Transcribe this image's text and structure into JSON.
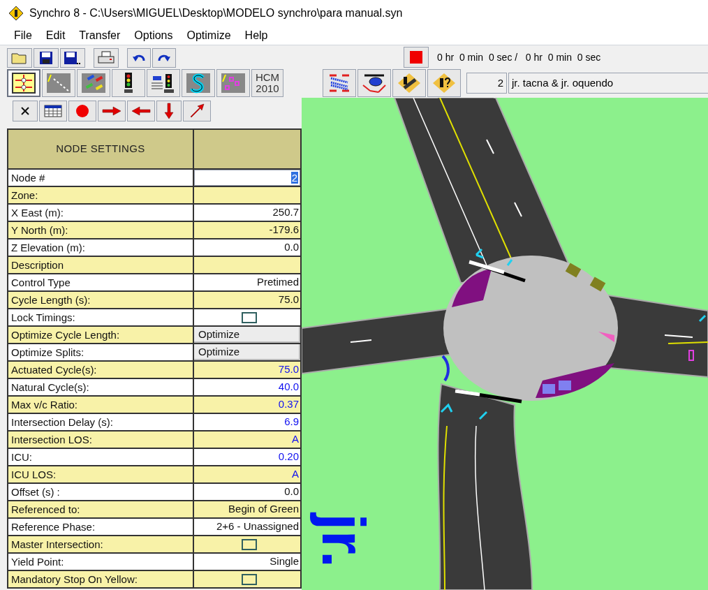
{
  "window": {
    "title": "Synchro 8 - C:\\Users\\MIGUEL\\Desktop\\MODELO synchro\\para manual.syn"
  },
  "menu": [
    "File",
    "Edit",
    "Transfer",
    "Options",
    "Optimize",
    "Help"
  ],
  "toolbar": {
    "hcm_button": "HCM 2010",
    "timer": "0 hr  0 min  0 sec /   0 hr  0 min  0 sec",
    "node_number": "2",
    "node_name": "jr. tacna & jr. oquendo"
  },
  "node_settings": {
    "title": "NODE SETTINGS",
    "rows": [
      {
        "label": "Node #",
        "kind": "input",
        "value": "2",
        "selected": true
      },
      {
        "label": "Zone:",
        "kind": "text",
        "value": ""
      },
      {
        "label": "X East (m):",
        "kind": "text",
        "value": "250.7",
        "calculated": false
      },
      {
        "label": "Y North (m):",
        "kind": "text",
        "value": "-179.6",
        "calculated": false
      },
      {
        "label": "Z Elevation (m):",
        "kind": "text",
        "value": "0.0",
        "calculated": false
      },
      {
        "label": "Description",
        "kind": "text",
        "value": ""
      },
      {
        "label": "Control Type",
        "kind": "text",
        "value": "Pretimed",
        "calculated": false
      },
      {
        "label": "Cycle Length (s):",
        "kind": "text",
        "value": "75.0",
        "calculated": false
      },
      {
        "label": "Lock Timings:",
        "kind": "checkbox",
        "checked": false
      },
      {
        "label": "Optimize Cycle Length:",
        "kind": "button",
        "value": "Optimize"
      },
      {
        "label": "Optimize Splits:",
        "kind": "button",
        "value": "Optimize"
      },
      {
        "label": "Actuated Cycle(s):",
        "kind": "text",
        "value": "75.0",
        "calculated": true
      },
      {
        "label": "Natural Cycle(s):",
        "kind": "text",
        "value": "40.0",
        "calculated": true
      },
      {
        "label": "Max v/c Ratio:",
        "kind": "text",
        "value": "0.37",
        "calculated": true
      },
      {
        "label": "Intersection Delay (s):",
        "kind": "text",
        "value": "6.9",
        "calculated": true
      },
      {
        "label": "Intersection LOS:",
        "kind": "text",
        "value": "A",
        "calculated": true
      },
      {
        "label": "ICU:",
        "kind": "text",
        "value": "0.20",
        "calculated": true
      },
      {
        "label": "ICU LOS:",
        "kind": "text",
        "value": "A",
        "calculated": true
      },
      {
        "label": "Offset (s) :",
        "kind": "text",
        "value": "0.0",
        "calculated": false
      },
      {
        "label": "Referenced to:",
        "kind": "text",
        "value": "Begin of Green",
        "calculated": false
      },
      {
        "label": "Reference Phase:",
        "kind": "text",
        "value": "2+6 - Unassigned",
        "calculated": false
      },
      {
        "label": "Master Intersection:",
        "kind": "checkbox",
        "checked": false
      },
      {
        "label": "Yield Point:",
        "kind": "text",
        "value": "Single",
        "calculated": false
      },
      {
        "label": "Mandatory Stop On Yellow:",
        "kind": "checkbox",
        "checked": false
      }
    ]
  },
  "map": {
    "street_label": "jr."
  }
}
